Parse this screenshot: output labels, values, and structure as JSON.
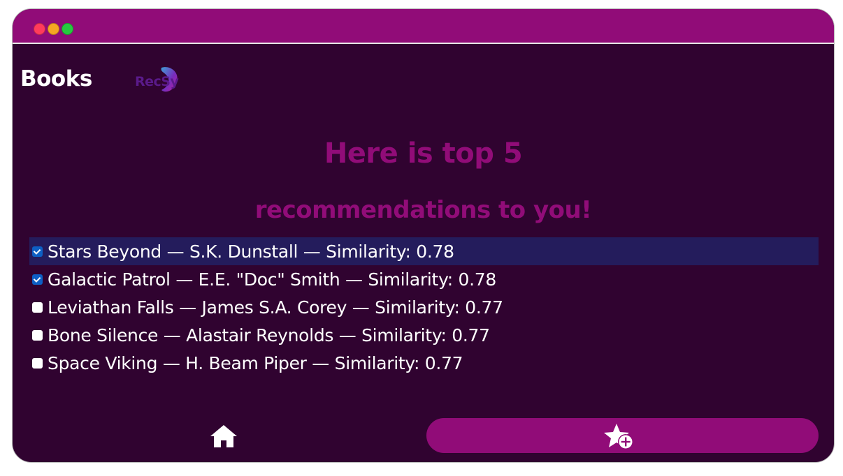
{
  "app": {
    "title": "Books",
    "logo_text": "RecSy"
  },
  "colors": {
    "window_bg": "#300330",
    "accent": "#910c78",
    "highlight_row": "#241c5c",
    "checkbox_checked": "#0d5fc4"
  },
  "window_controls": {
    "close_color": "#ff3b5c",
    "minimize_color": "#f5a623",
    "maximize_color": "#27c93f"
  },
  "headings": {
    "line1": "Here is top 5",
    "line2": "recommendations to you!"
  },
  "recommendations": [
    {
      "label": "Stars Beyond — S.K. Dunstall — Similarity: 0.78",
      "checked": true,
      "highlighted": true
    },
    {
      "label": "Galactic Patrol — E.E. \"Doc\" Smith — Similarity: 0.78",
      "checked": true,
      "highlighted": false
    },
    {
      "label": "Leviathan Falls — James S.A. Corey — Similarity: 0.77",
      "checked": false,
      "highlighted": false
    },
    {
      "label": "Bone Silence — Alastair Reynolds — Similarity: 0.77",
      "checked": false,
      "highlighted": false
    },
    {
      "label": "Space Viking — H. Beam Piper — Similarity: 0.77",
      "checked": false,
      "highlighted": false
    }
  ],
  "nav": {
    "home_icon": "home-icon",
    "add_favorite_icon": "star-plus-icon"
  }
}
